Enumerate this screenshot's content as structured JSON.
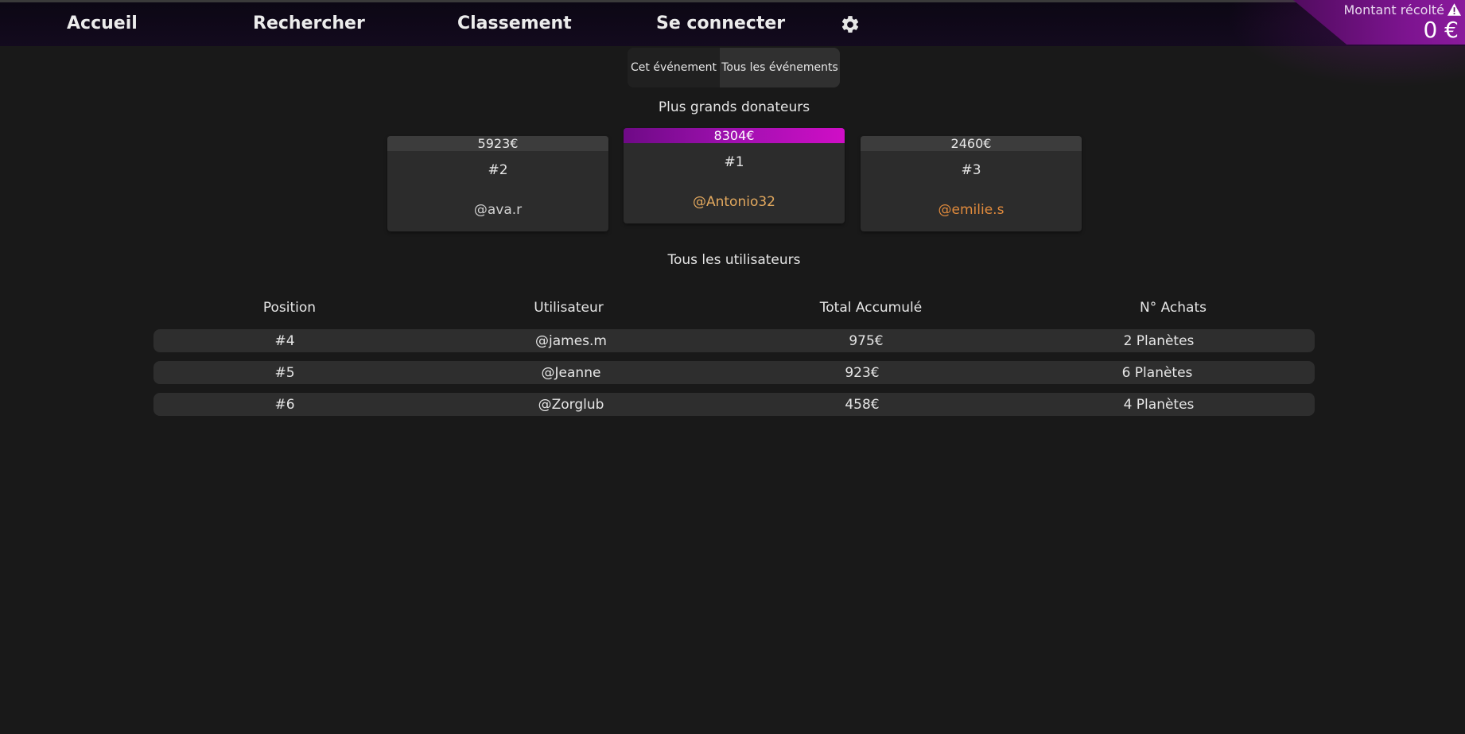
{
  "nav": {
    "home": "Accueil",
    "search": "Rechercher",
    "ranking": "Classement",
    "login": "Se connecter"
  },
  "collected": {
    "label": "Montant récolté",
    "value": "0 €"
  },
  "scope_toggle": {
    "this_event": "Cet événement",
    "all_events": "Tous les événements"
  },
  "top_donors": {
    "title": "Plus grands donateurs",
    "first": {
      "amount": "8304€",
      "rank": "#1",
      "user": "@Antonio32"
    },
    "second": {
      "amount": "5923€",
      "rank": "#2",
      "user": "@ava.r"
    },
    "third": {
      "amount": "2460€",
      "rank": "#3",
      "user": "@emilie.s"
    }
  },
  "all_users": {
    "title": "Tous les utilisateurs",
    "headers": {
      "position": "Position",
      "user": "Utilisateur",
      "total": "Total Accumulé",
      "purchases": "N° Achats"
    },
    "rows": [
      {
        "position": "#4",
        "user": "@james.m",
        "total": "975€",
        "purchases": "2 Planètes"
      },
      {
        "position": "#5",
        "user": "@Jeanne",
        "total": "923€",
        "purchases": "6 Planètes"
      },
      {
        "position": "#6",
        "user": "@Zorglub",
        "total": "458€",
        "purchases": "4 Planètes"
      }
    ]
  },
  "colors": {
    "accent": "#a010b0",
    "gold": "#e2a85e",
    "bronze": "#e08a3c"
  },
  "icons": {
    "settings": "gear-icon",
    "warning": "warning-icon"
  }
}
